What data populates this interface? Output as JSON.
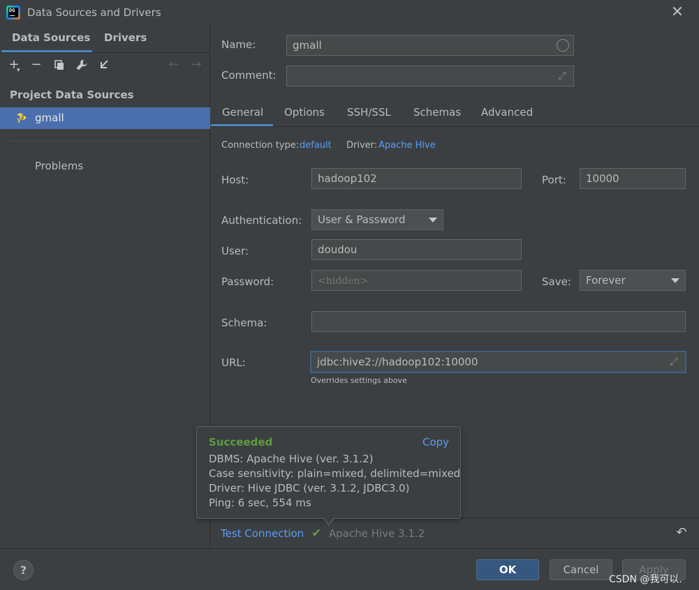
{
  "window": {
    "title": "Data Sources and Drivers"
  },
  "left": {
    "tabs": [
      "Data Sources",
      "Drivers"
    ],
    "section_header": "Project Data Sources",
    "tree_items": [
      "gmall"
    ],
    "problems": "Problems"
  },
  "form": {
    "name_label": "Name:",
    "name_value": "gmall",
    "comment_label": "Comment:",
    "comment_value": "",
    "tabs": [
      "General",
      "Options",
      "SSH/SSL",
      "Schemas",
      "Advanced"
    ],
    "connection_type_label": "Connection type:",
    "connection_type_value": "default",
    "driver_label": "Driver:",
    "driver_value": "Apache Hive",
    "host_label": "Host:",
    "host_value": "hadoop102",
    "port_label": "Port:",
    "port_value": "10000",
    "auth_label": "Authentication:",
    "auth_value": "User & Password",
    "user_label": "User:",
    "user_value": "doudou",
    "password_label": "Password:",
    "password_placeholder": "<hidden>",
    "save_label": "Save:",
    "save_value": "Forever",
    "schema_label": "Schema:",
    "schema_value": "",
    "url_label": "URL:",
    "url_value": "jdbc:hive2://hadoop102:10000",
    "url_hint": "Overrides settings above"
  },
  "popup": {
    "status": "Succeeded",
    "copy": "Copy",
    "lines": [
      "DBMS: Apache Hive (ver. 3.1.2)",
      "Case sensitivity: plain=mixed, delimited=mixed",
      "Driver: Hive JDBC (ver. 3.1.2, JDBC3.0)",
      "Ping: 6 sec, 554 ms"
    ]
  },
  "bottom": {
    "test_connection": "Test Connection",
    "driver_version": "Apache Hive 3.1.2"
  },
  "footer": {
    "help": "?",
    "ok": "OK",
    "cancel": "Cancel",
    "apply": "Apply",
    "watermark": "CSDN @我可以."
  },
  "icons": {
    "app": "datagrip-logo-icon",
    "close": "close-icon",
    "add": "plus-icon",
    "remove": "minus-icon",
    "duplicate": "copy-icon",
    "properties": "wrench-icon",
    "import": "import-arrow-icon",
    "back": "arrow-left-icon",
    "forward": "arrow-right-icon",
    "hive": "hive-bee-icon",
    "check": "check-icon",
    "revert": "revert-icon"
  },
  "colors": {
    "accent": "#4a88c7",
    "selection": "#4b6eaf",
    "link": "#589df6",
    "success": "#5e9c40",
    "ok_button": "#365880"
  }
}
